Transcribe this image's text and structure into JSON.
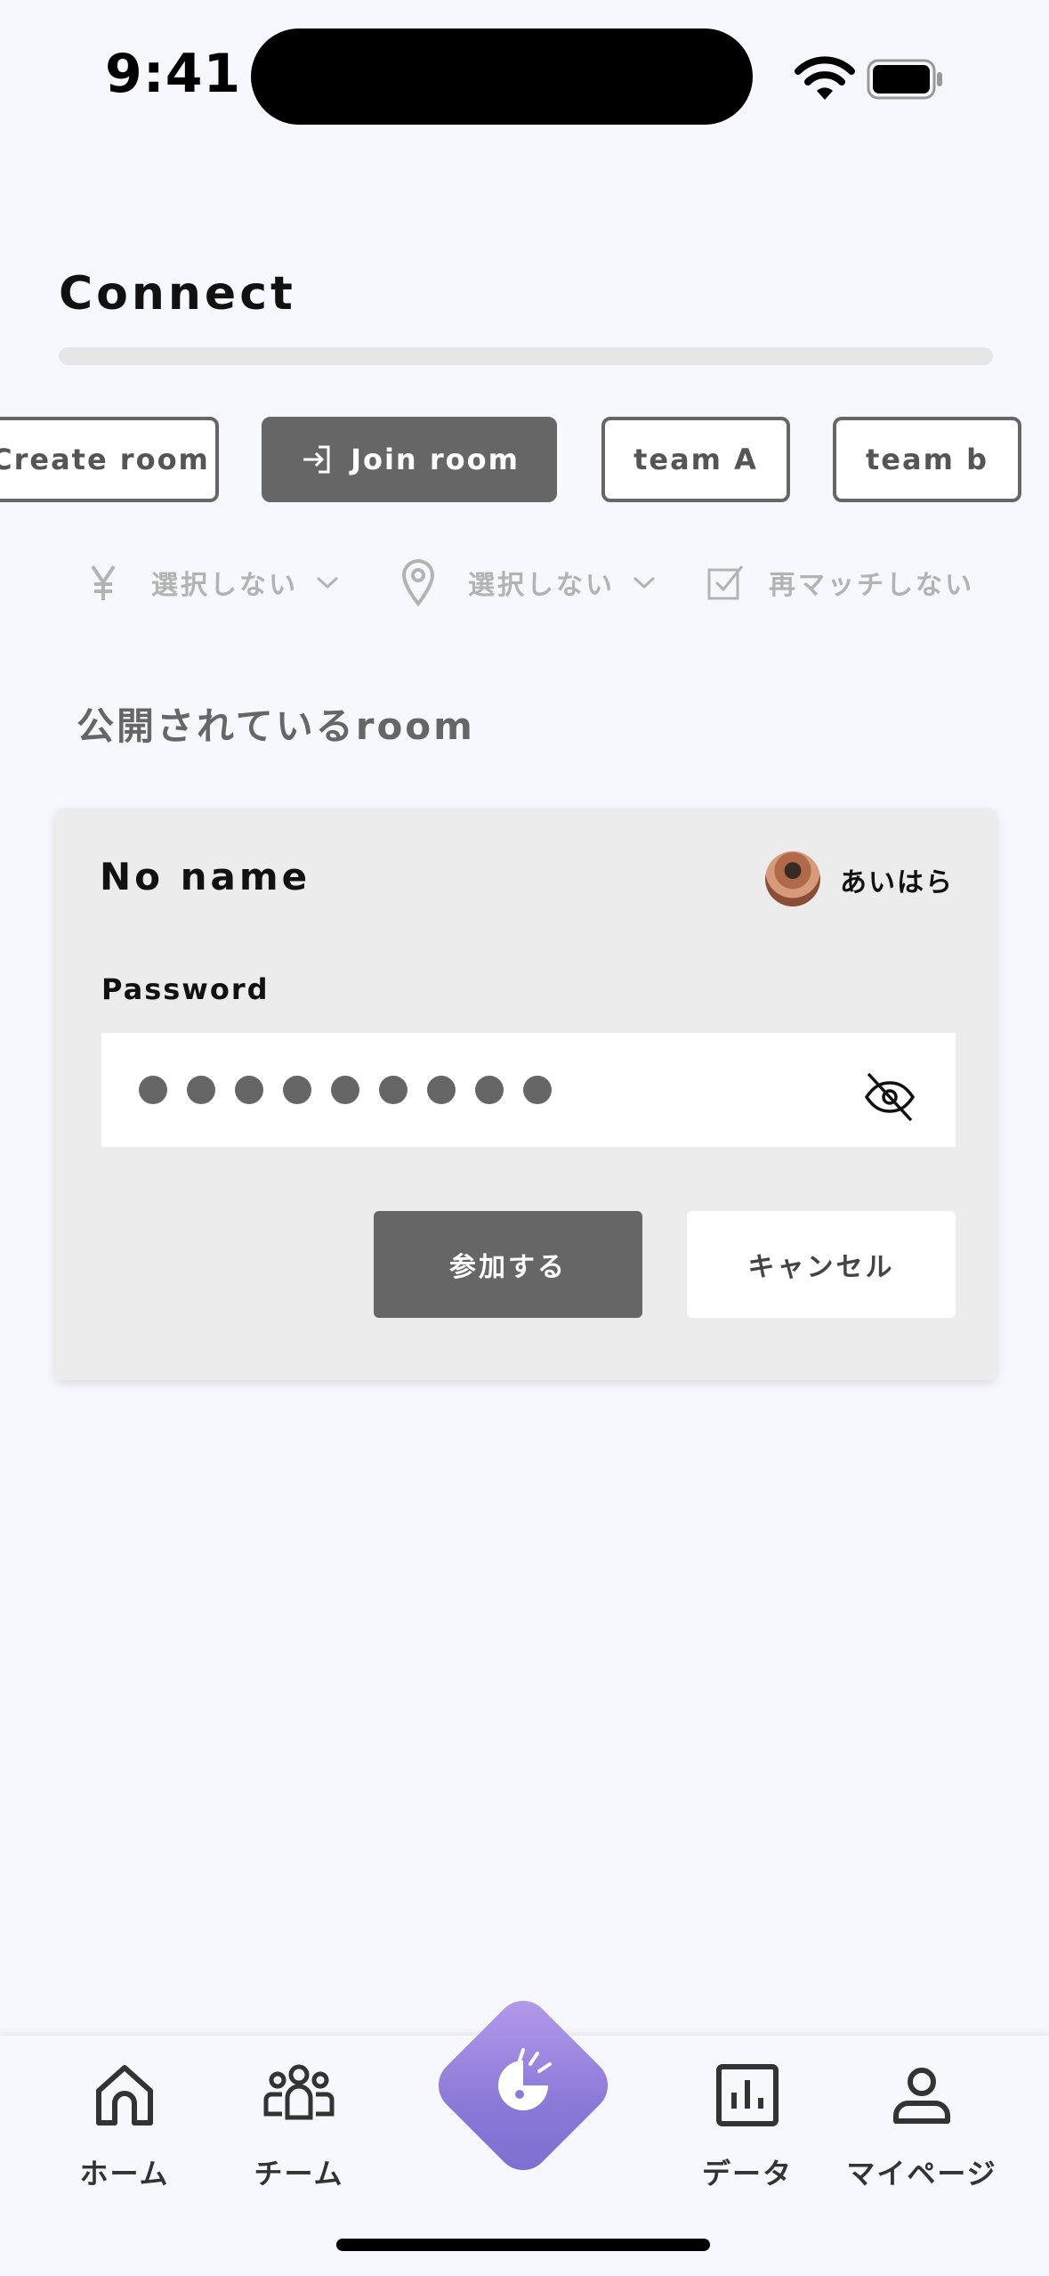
{
  "status_bar": {
    "time": "9:41"
  },
  "header": {
    "title": "Connect"
  },
  "tabs": [
    {
      "label": "Create room",
      "icon": "none"
    },
    {
      "label": "Join room",
      "icon": "login-icon"
    },
    {
      "label": "team A"
    },
    {
      "label": "team b"
    }
  ],
  "filters": [
    {
      "label": "選択しない",
      "icon": "yen-icon"
    },
    {
      "label": "選択しない",
      "icon": "location-pin-icon"
    },
    {
      "label": "再マッチしない",
      "icon": "checkbox-icon"
    }
  ],
  "section": {
    "title": "公開されているroom"
  },
  "room_card": {
    "name": "No name",
    "owner": "あいはら",
    "password_label": "Password",
    "masked_length": 9,
    "join_label": "参加する",
    "cancel_label": "キャンセル"
  },
  "bottom_nav": [
    {
      "label": "ホーム",
      "icon": "home-icon"
    },
    {
      "label": "チーム",
      "icon": "team-icon"
    },
    {
      "label": "",
      "icon": "timer-icon"
    },
    {
      "label": "データ",
      "icon": "chart-icon"
    },
    {
      "label": "マイページ",
      "icon": "user-icon"
    }
  ],
  "colors": {
    "background": "#f7f8fe",
    "accent": "#666666",
    "center_gradient_start": "#b79cec",
    "center_gradient_end": "#7a6dd0"
  }
}
